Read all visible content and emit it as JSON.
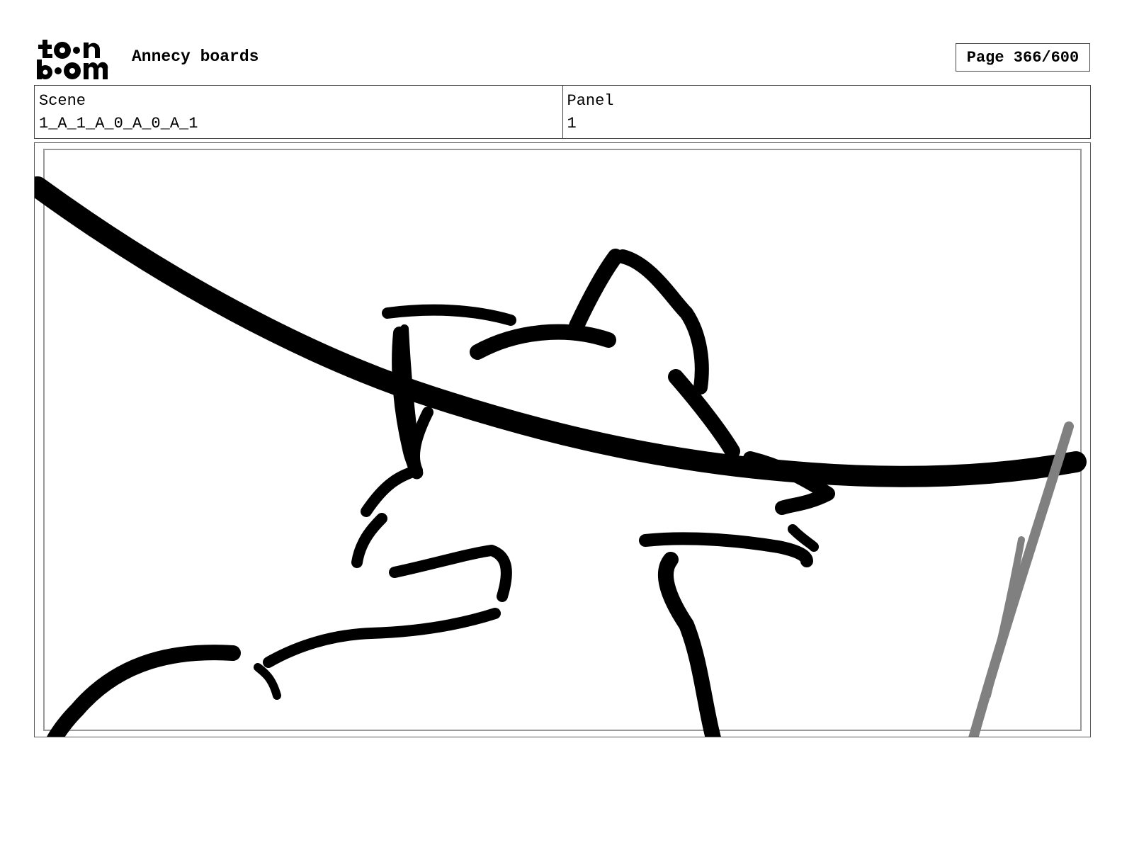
{
  "header": {
    "logo_text": "toon boom",
    "title": "Annecy boards",
    "page_label": "Page 366/600"
  },
  "info": {
    "scene_label": "Scene",
    "scene_value": "1_A_1_A_0_A_0_A_1",
    "panel_label": "Panel",
    "panel_value": "1"
  },
  "colors": {
    "ink": "#000000",
    "secondary_stroke": "#808080",
    "frame": "#999999"
  }
}
